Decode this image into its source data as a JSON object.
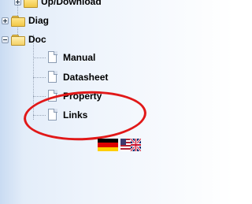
{
  "tree": {
    "items": [
      {
        "label": "Up/Download",
        "type": "folder",
        "state": "collapsed"
      },
      {
        "label": "Diag",
        "type": "folder",
        "state": "collapsed"
      },
      {
        "label": "Doc",
        "type": "folder",
        "state": "expanded",
        "children": [
          {
            "label": "Manual",
            "type": "document"
          },
          {
            "label": "Datasheet",
            "type": "document"
          },
          {
            "label": "Property",
            "type": "document"
          },
          {
            "label": "Links",
            "type": "document"
          }
        ]
      }
    ]
  },
  "flags": [
    {
      "name": "german-flag-icon"
    },
    {
      "name": "us-uk-flag-icon"
    }
  ],
  "annotation": {
    "shape": "ellipse",
    "color": "#e11818",
    "target": "Links"
  }
}
